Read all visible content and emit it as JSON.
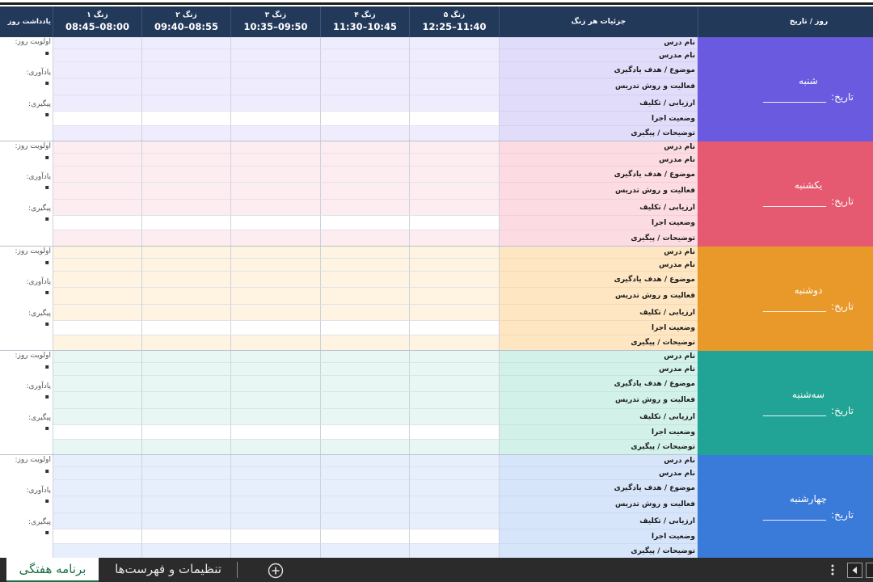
{
  "header": {
    "notes_col": "یادداشت روز",
    "bells": [
      {
        "label": "زنگ ۱",
        "time": "08:45–08:00"
      },
      {
        "label": "زنگ ۲",
        "time": "09:40–08:55"
      },
      {
        "label": "زنگ ۳",
        "time": "10:35–09:50"
      },
      {
        "label": "زنگ ۴",
        "time": "11:30–10:45"
      },
      {
        "label": "زنگ ۵",
        "time": "12:25–11:40"
      }
    ],
    "details_col": "جزئیات هر زنگ",
    "day_col": "روز / تاریخ"
  },
  "row_labels": [
    "نام درس",
    "نام مدرس",
    "موضوع / هدف یادگیری",
    "فعالیت و روش تدریس",
    "ارزیابی / تکلیف",
    "وضعیت اجرا",
    "توضیحات / پیگیری"
  ],
  "notes_labels": [
    "اولویت روز:",
    "یادآوری:",
    "پیگیری:"
  ],
  "notes_bullet": "▪",
  "date_label": "تاریخ:",
  "date_blank": "_____________",
  "days": [
    {
      "name": "شنبه",
      "color": "#6a5ae0",
      "detail_bg": "#e1dcfa",
      "cell_bg": "#efedfd"
    },
    {
      "name": "یکشنبه",
      "color": "#e65a71",
      "detail_bg": "#fcdce2",
      "cell_bg": "#fdedf0"
    },
    {
      "name": "دوشنبه",
      "color": "#e8992a",
      "detail_bg": "#ffe6c2",
      "cell_bg": "#fff3e1"
    },
    {
      "name": "سه‌شنبه",
      "color": "#21a495",
      "detail_bg": "#d2f1e9",
      "cell_bg": "#e8f7f3"
    },
    {
      "name": "چهارشنبه",
      "color": "#3a7ad8",
      "detail_bg": "#d7e5fb",
      "cell_bg": "#e7effc"
    }
  ],
  "tabs": [
    {
      "label": "برنامه هفتگی",
      "active": true
    },
    {
      "label": "تنظیمات و فهرست‌ها",
      "active": false
    }
  ],
  "icons": {
    "add_sheet": "plus-circle-icon",
    "more_options": "vertical-ellipsis-icon",
    "scroll_left": "caret-left-icon"
  },
  "colors": {
    "header_bg": "#22395a",
    "tab_bar_bg": "#2b2b2b",
    "active_tab_text": "#1e7145",
    "empty_row_bg": "#ffffff"
  }
}
